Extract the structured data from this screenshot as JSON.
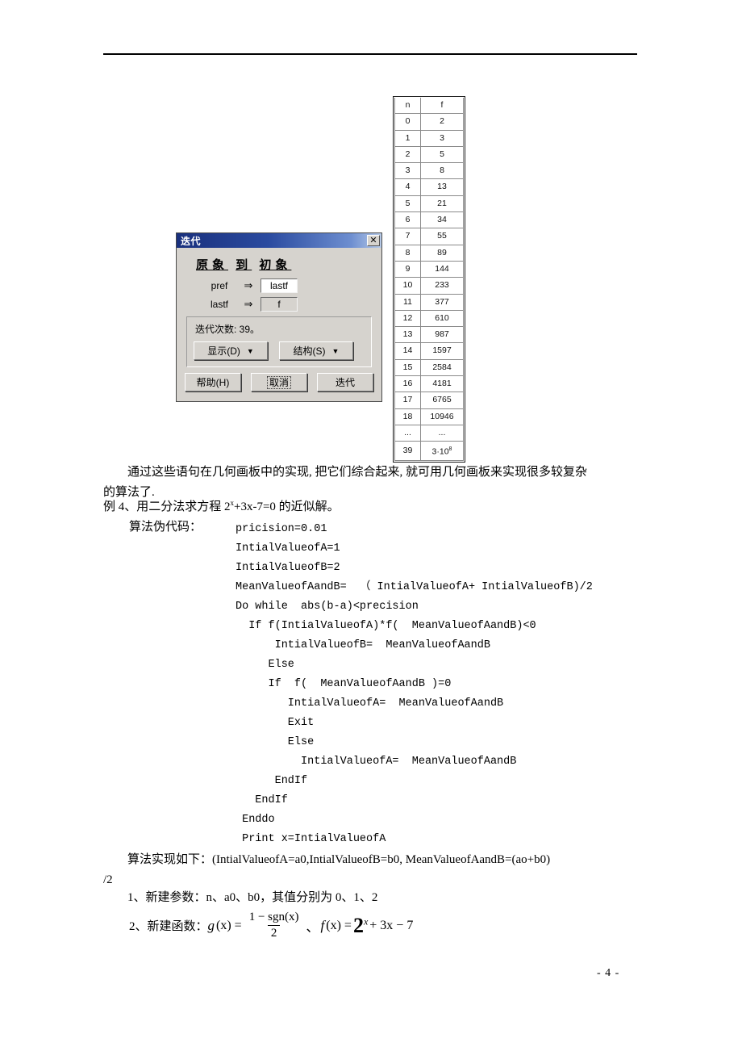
{
  "page": {
    "footer_label": "- 4 -"
  },
  "fib_table": {
    "headers": [
      "n",
      "f"
    ],
    "rows": [
      [
        "0",
        "2"
      ],
      [
        "1",
        "3"
      ],
      [
        "2",
        "5"
      ],
      [
        "3",
        "8"
      ],
      [
        "4",
        "13"
      ],
      [
        "5",
        "21"
      ],
      [
        "6",
        "34"
      ],
      [
        "7",
        "55"
      ],
      [
        "8",
        "89"
      ],
      [
        "9",
        "144"
      ],
      [
        "10",
        "233"
      ],
      [
        "11",
        "377"
      ],
      [
        "12",
        "610"
      ],
      [
        "13",
        "987"
      ],
      [
        "14",
        "1597"
      ],
      [
        "15",
        "2584"
      ],
      [
        "16",
        "4181"
      ],
      [
        "17",
        "6765"
      ],
      [
        "18",
        "10946"
      ],
      [
        "...",
        "..."
      ],
      [
        "39",
        "3·10"
      ]
    ],
    "last_exponent": "8"
  },
  "dialog": {
    "title": "迭代",
    "close_label": "✕",
    "heading_parts": [
      "原象",
      "到",
      "初象"
    ],
    "mappings": [
      {
        "source": "pref",
        "arrow": "⇒",
        "target": "lastf",
        "state": "filled"
      },
      {
        "source": "lastf",
        "arrow": "⇒",
        "target": "f",
        "state": "blank"
      }
    ],
    "count_label": "迭代次数: 39。",
    "display_button": "显示(D)",
    "structure_button": "结构(S)",
    "caret": "▼",
    "help_button": "帮助(H)",
    "cancel_button": "取消",
    "iterate_button": "迭代"
  },
  "body": {
    "para1_line1": "通过这些语句在几何画板中的实现, 把它们综合起来, 就可用几何画板来实现很多较复杂",
    "para1_line2": "的算法了.",
    "example_prefix": "例 4、用二分法求方程 2",
    "example_exponent": "x",
    "example_suffix": "+3x-7=0 的近似解。",
    "pseudocode_label": "算法伪代码：",
    "pseudocode_lines": [
      "pricision=0.01",
      "IntialValueofA=1",
      "IntialValueofB=2",
      "MeanValueofAandB=  （ IntialValueofA+ IntialValueofB)/2",
      "Do while  abs(b-a)<precision",
      "  If f(IntialValueofA)*f(  MeanValueofAandB)<0",
      "      IntialValueofB=  MeanValueofAandB",
      "     Else",
      "     If  f(  MeanValueofAandB )=0",
      "        IntialValueofA=  MeanValueofAandB",
      "        Exit",
      "        Else",
      "          IntialValueofA=  MeanValueofAandB",
      "      EndIf",
      "   EndIf",
      " Enddo",
      " Print x=IntialValueofA"
    ],
    "impl_line1": "算法实现如下：(IntialValueofA=a0,IntialValueofB=b0,  MeanValueofAandB=(ao+b0)",
    "impl_line2": "/2",
    "step1": "1、新建参数：n、a0、b0，其值分别为 0、1、2",
    "step2_label": "2、新建函数：",
    "formula": {
      "g_name": "g",
      "g_arg": "(x)",
      "equals": "=",
      "numerator": "1 − sgn(x)",
      "denominator": "2",
      "separator": "、",
      "f_name": "f",
      "f_arg": "(x)",
      "base": "2",
      "exponent": "x",
      "tail": "+ 3x − 7"
    }
  }
}
